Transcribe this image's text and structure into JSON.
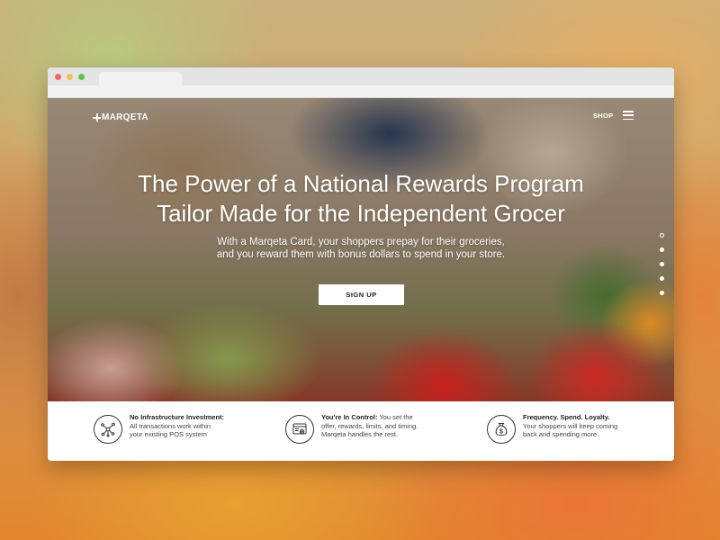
{
  "brand": {
    "logo_text": "MARQETA"
  },
  "nav": {
    "shop_label": "SHOP",
    "menu_icon": "hamburger-menu-icon"
  },
  "hero": {
    "headline_line1": "The Power of a National Rewards Program",
    "headline_line2": "Tailor Made for the Independent Grocer",
    "subline_line1": "With a Marqeta Card, your shoppers prepay for their groceries,",
    "subline_line2": "and you reward them with bonus dollars to spend in your store.",
    "cta_label": "SIGN UP",
    "carousel": {
      "count": 5,
      "active_index": 0
    }
  },
  "features": [
    {
      "icon": "network-nodes-icon",
      "title": "No Infrastructure Investment:",
      "line1": "All transactions work within",
      "line2": "your existing POS system"
    },
    {
      "icon": "browser-settings-icon",
      "title": "You're In Control:",
      "line1": "You set the",
      "line2": "offer, rewards, limits, and timing.",
      "line3": "Marqeta handles the rest."
    },
    {
      "icon": "money-bag-icon",
      "title": "Frequency. Spend. Loyalty.",
      "line1": "Your shoppers will keep coming",
      "line2": "back and spending more."
    }
  ]
}
